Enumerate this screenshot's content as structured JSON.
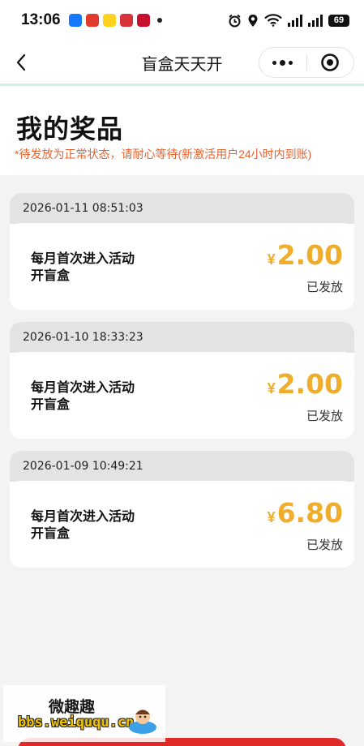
{
  "status_bar": {
    "time": "13:06",
    "battery": "69",
    "network_1": "4G",
    "network_2": "4G"
  },
  "nav": {
    "title": "盲盒天天开",
    "back_icon": "chevron-left-icon",
    "more_icon": "more-dots-icon",
    "close_icon": "target-circle-icon"
  },
  "header": {
    "title": "我的奖品",
    "notice": "*待发放为正常状态，请耐心等待(新激活用户24小时内到账)"
  },
  "colors": {
    "accent_orange": "#f0ac2b",
    "notice_red": "#e8622e",
    "divider_green": "#cdeee2",
    "button_red": "#e02a2a"
  },
  "prizes": [
    {
      "time": "2026-01-11 08:51:03",
      "desc_line1": "每月首次进入活动",
      "desc_line2": "开盲盒",
      "currency": "¥",
      "amount": "2.00",
      "status": "已发放"
    },
    {
      "time": "2026-01-10 18:33:23",
      "desc_line1": "每月首次进入活动",
      "desc_line2": "开盲盒",
      "currency": "¥",
      "amount": "2.00",
      "status": "已发放"
    },
    {
      "time": "2026-01-09 10:49:21",
      "desc_line1": "每月首次进入活动",
      "desc_line2": "开盲盒",
      "currency": "¥",
      "amount": "6.80",
      "status": "已发放"
    }
  ],
  "watermark": {
    "top": "微趣趣",
    "bottom": "bbs.weiququ.cn"
  }
}
